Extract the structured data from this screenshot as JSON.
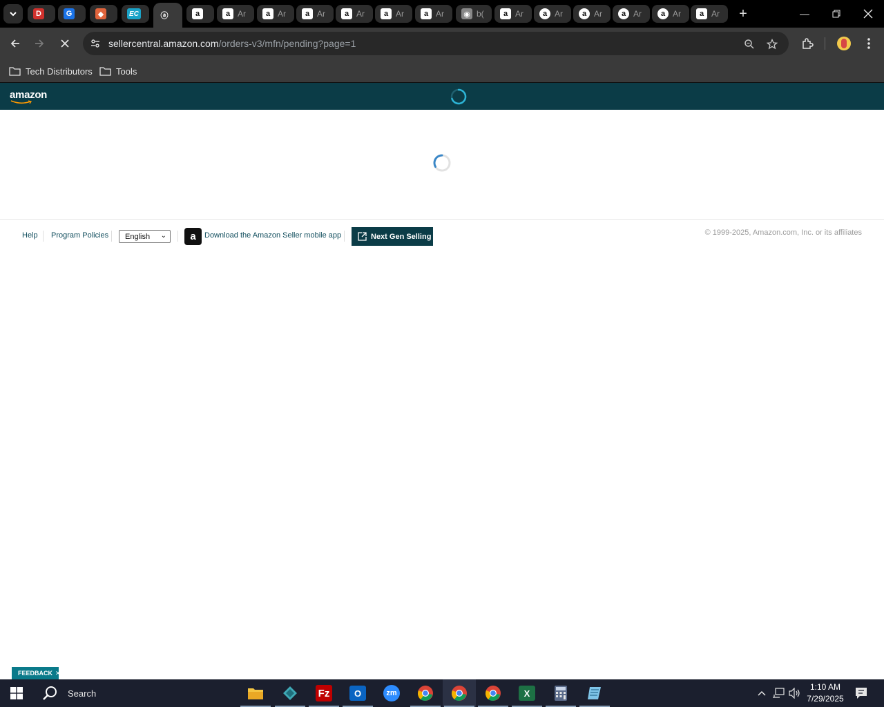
{
  "browser": {
    "tabs": [
      {
        "icon": "red-logo-icon",
        "label": "",
        "color": "#d0312d",
        "glyph": "D"
      },
      {
        "icon": "blue-g-icon",
        "label": "",
        "color": "#1a73e8",
        "glyph": "G"
      },
      {
        "icon": "cube-icon",
        "label": "",
        "color": "#e0643c",
        "glyph": "◆"
      },
      {
        "icon": "ec-icon",
        "label": "",
        "color": "#1aa3c8",
        "glyph": "EC"
      },
      {
        "icon": "amazon-seller-icon",
        "label": "",
        "color": "#3a3a3a",
        "glyph": "ⓐ"
      },
      {
        "icon": "amazon-icon",
        "label": "",
        "color": "#fff",
        "glyph": "a"
      },
      {
        "icon": "amazon-icon",
        "label": "Ar",
        "color": "#fff",
        "glyph": "a"
      },
      {
        "icon": "amazon-icon",
        "label": "Ar",
        "color": "#fff",
        "glyph": "a"
      },
      {
        "icon": "amazon-icon",
        "label": "Ar",
        "color": "#fff",
        "glyph": "a"
      },
      {
        "icon": "amazon-icon",
        "label": "Ar",
        "color": "#fff",
        "glyph": "a"
      },
      {
        "icon": "amazon-icon",
        "label": "Ar",
        "color": "#fff",
        "glyph": "a"
      },
      {
        "icon": "amazon-icon",
        "label": "Ar",
        "color": "#fff",
        "glyph": "a"
      },
      {
        "icon": "globe-icon",
        "label": "b(",
        "color": "#888",
        "glyph": "◉"
      },
      {
        "icon": "amazon-icon",
        "label": "Ar",
        "color": "#fff",
        "glyph": "a"
      },
      {
        "icon": "amazon-round-icon",
        "label": "Ar",
        "color": "#fff",
        "glyph": "a"
      },
      {
        "icon": "amazon-round-icon",
        "label": "Ar",
        "color": "#fff",
        "glyph": "a"
      },
      {
        "icon": "amazon-round-icon",
        "label": "Ar",
        "color": "#fff",
        "glyph": "a"
      },
      {
        "icon": "amazon-round-icon",
        "label": "Ar",
        "color": "#fff",
        "glyph": "a"
      },
      {
        "icon": "amazon-icon",
        "label": "Ar",
        "color": "#fff",
        "glyph": "a"
      }
    ],
    "url_host": "sellercentral.amazon.com",
    "url_path": "/orders-v3/mfn/pending?page=1",
    "bookmarks": [
      "Tech Distributors",
      "Tools"
    ]
  },
  "page": {
    "logo": "amazon",
    "footer": {
      "help": "Help",
      "program_policies": "Program Policies",
      "language": "English",
      "download_app": "Download the Amazon Seller mobile app",
      "next_gen": "Next Gen Selling",
      "copyright": "© 1999-2025, Amazon.com, Inc. or its affiliates"
    },
    "feedback": "FEEDBACK"
  },
  "taskbar": {
    "search_label": "Search",
    "time": "1:10 AM",
    "date": "7/29/2025"
  },
  "colors": {
    "header_teal": "#0b3c47",
    "spinner": "#3a87c7",
    "feedback": "#0a7a8a"
  }
}
